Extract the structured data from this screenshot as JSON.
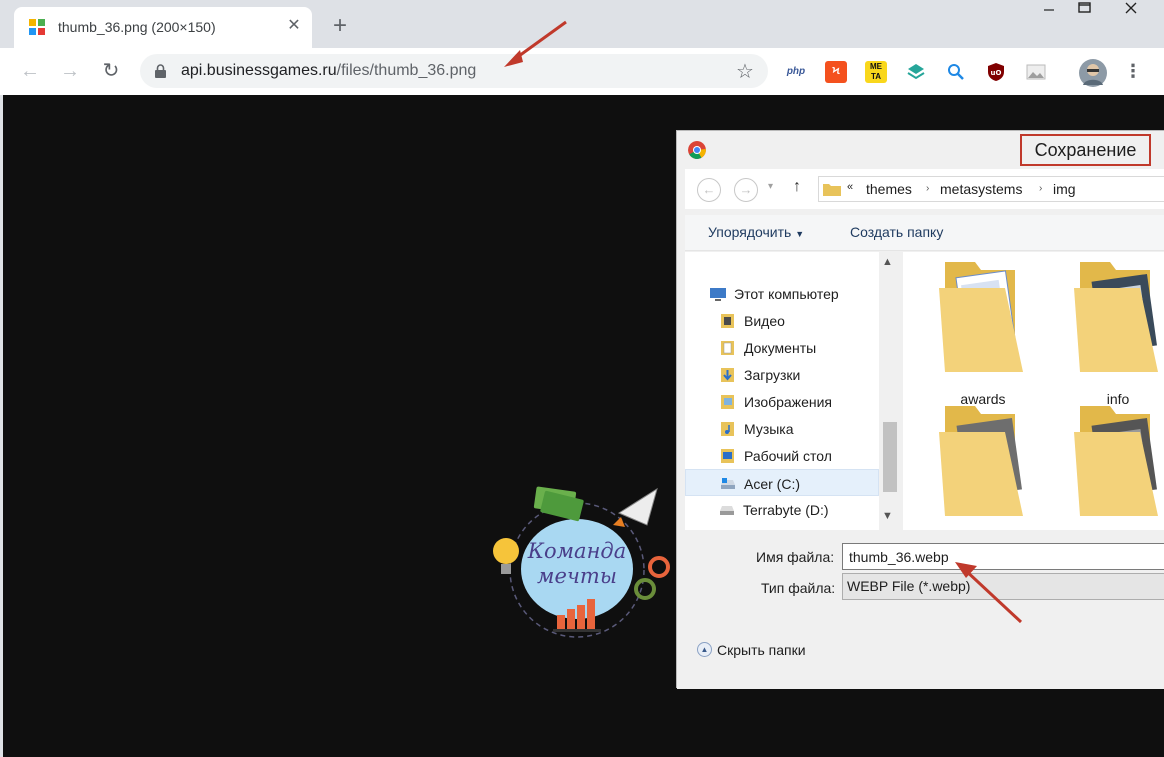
{
  "browser": {
    "tab": {
      "title": "thumb_36.png (200×150)",
      "close": "✕"
    },
    "new_tab": "+",
    "url": {
      "host": "api.businessgames.ru",
      "path": "/files/thumb_36.png"
    },
    "extensions": [
      "php",
      "ya",
      "META",
      "layers",
      "search",
      "uBlock",
      "image"
    ]
  },
  "page": {
    "image_text_line1": "Команда",
    "image_text_line2": "мечты"
  },
  "dialog": {
    "title": "Сохранение",
    "breadcrumb": {
      "chevrons": "«",
      "segments": [
        "themes",
        "metasystems",
        "img"
      ]
    },
    "toolbar": {
      "organize": "Упорядочить",
      "new_folder": "Создать папку"
    },
    "tree": [
      {
        "label": "Этот компьютер",
        "icon": "computer-icon"
      },
      {
        "label": "Видео",
        "icon": "video-folder-icon"
      },
      {
        "label": "Документы",
        "icon": "documents-folder-icon"
      },
      {
        "label": "Загрузки",
        "icon": "downloads-folder-icon"
      },
      {
        "label": "Изображения",
        "icon": "pictures-folder-icon"
      },
      {
        "label": "Музыка",
        "icon": "music-folder-icon"
      },
      {
        "label": "Рабочий стол",
        "icon": "desktop-folder-icon"
      },
      {
        "label": "Acer (C:)",
        "icon": "drive-icon",
        "selected": true
      },
      {
        "label": "Terrabyte (D:)",
        "icon": "drive-icon"
      }
    ],
    "folders": [
      {
        "label": "awards"
      },
      {
        "label": "info"
      },
      {
        "label": ""
      },
      {
        "label": ""
      }
    ],
    "filename": {
      "label": "Имя файла:",
      "value": "thumb_36.webp"
    },
    "filetype": {
      "label": "Тип файла:",
      "value": "WEBP File (*.webp)"
    },
    "hide_folders": "Скрыть папки"
  },
  "colors": {
    "annotation_arrow": "#c0392b",
    "page_bg": "#0f0f0f",
    "tab_bg": "#dee1e6"
  }
}
